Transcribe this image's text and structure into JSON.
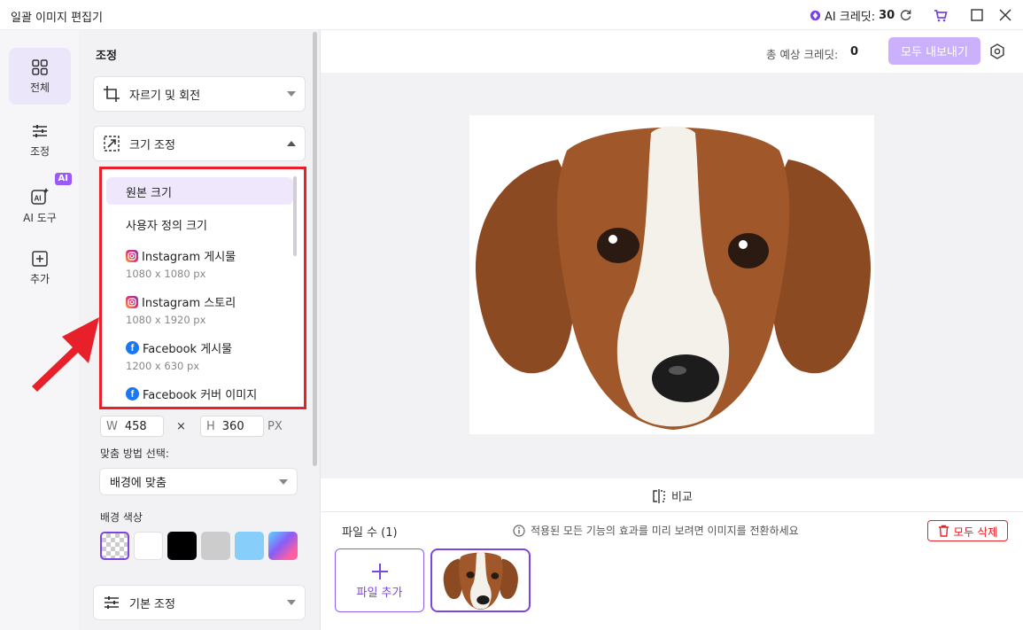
{
  "window": {
    "title": "일괄 이미지 편집기",
    "credit_label": "AI 크레딧:",
    "credit_value": "30"
  },
  "rail": {
    "items": [
      {
        "label": "전체",
        "icon": "grid-icon",
        "active": true
      },
      {
        "label": "조정",
        "icon": "sliders-icon"
      },
      {
        "label": "AI 도구",
        "icon": "ai-tool-icon",
        "badge": "AI"
      },
      {
        "label": "추가",
        "icon": "plus-box-icon"
      }
    ]
  },
  "panel": {
    "title": "조정",
    "crop_label": "자르기 및 회전",
    "resize_label": "크기 조정",
    "basic_label": "기본 조정",
    "size_options": [
      {
        "name": "원본 크기",
        "dim": "",
        "icon": "",
        "selected": true
      },
      {
        "name": "사용자 정의 크기",
        "dim": "",
        "icon": ""
      },
      {
        "name": "Instagram 게시물",
        "dim": "1080 x 1080 px",
        "icon": "instagram-icon"
      },
      {
        "name": "Instagram 스토리",
        "dim": "1080 x 1920 px",
        "icon": "instagram-icon"
      },
      {
        "name": "Facebook 게시물",
        "dim": "1200 x 630 px",
        "icon": "facebook-icon"
      },
      {
        "name": "Facebook 커버 이미지",
        "dim": "",
        "icon": "facebook-icon"
      }
    ],
    "width_label": "W",
    "width_value": "458",
    "height_label": "H",
    "height_value": "360",
    "times": "×",
    "unit": "PX",
    "fit_label": "맞춤 방법 선택:",
    "fit_value": "배경에 맞춤",
    "bg_label": "배경 색상",
    "swatches": [
      "transparent",
      "#ffffff",
      "#000000",
      "#cccccc",
      "#87cefa",
      "gradient"
    ]
  },
  "main": {
    "estimate_label": "총 예상 크레딧:",
    "estimate_value": "0",
    "export_label": "모두 내보내기",
    "compare_label": "비교",
    "file_count": "파일 수 (1)",
    "hint": "적용된 모든 기능의 효과를 미리 보려면 이미지를 전환하세요",
    "delete_all": "모두 삭제",
    "add_file": "파일 추가"
  },
  "colors": {
    "accent": "#7a46e0",
    "highlight_border": "#e8202a",
    "export_bg": "#cbb1fb"
  }
}
